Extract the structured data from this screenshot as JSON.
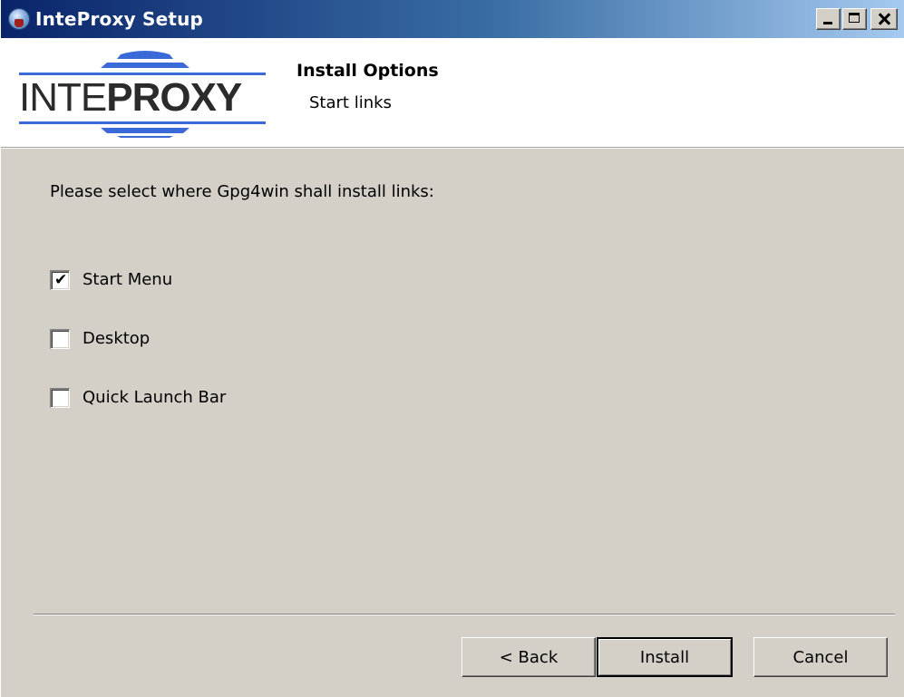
{
  "window": {
    "title": "InteProxy Setup"
  },
  "titlebar_buttons": {
    "minimize_icon": "minimize-icon",
    "maximize_icon": "maximize-icon",
    "close_icon": "close-icon"
  },
  "header": {
    "logo_text_light": "INTE",
    "logo_text_bold": "PROXY",
    "title": "Install Options",
    "subtitle": "Start links"
  },
  "body": {
    "prompt": "Please select where Gpg4win shall install links:",
    "options": [
      {
        "label": "Start Menu",
        "checked": true
      },
      {
        "label": "Desktop",
        "checked": false
      },
      {
        "label": "Quick Launch Bar",
        "checked": false
      }
    ]
  },
  "buttons": {
    "back": "< Back",
    "install": "Install",
    "cancel": "Cancel"
  },
  "colors": {
    "title_gradient_start": "#0a246a",
    "title_gradient_end": "#a6caf0",
    "dialog_face": "#d4d0c8",
    "logo_blue": "#3a6ad8"
  }
}
